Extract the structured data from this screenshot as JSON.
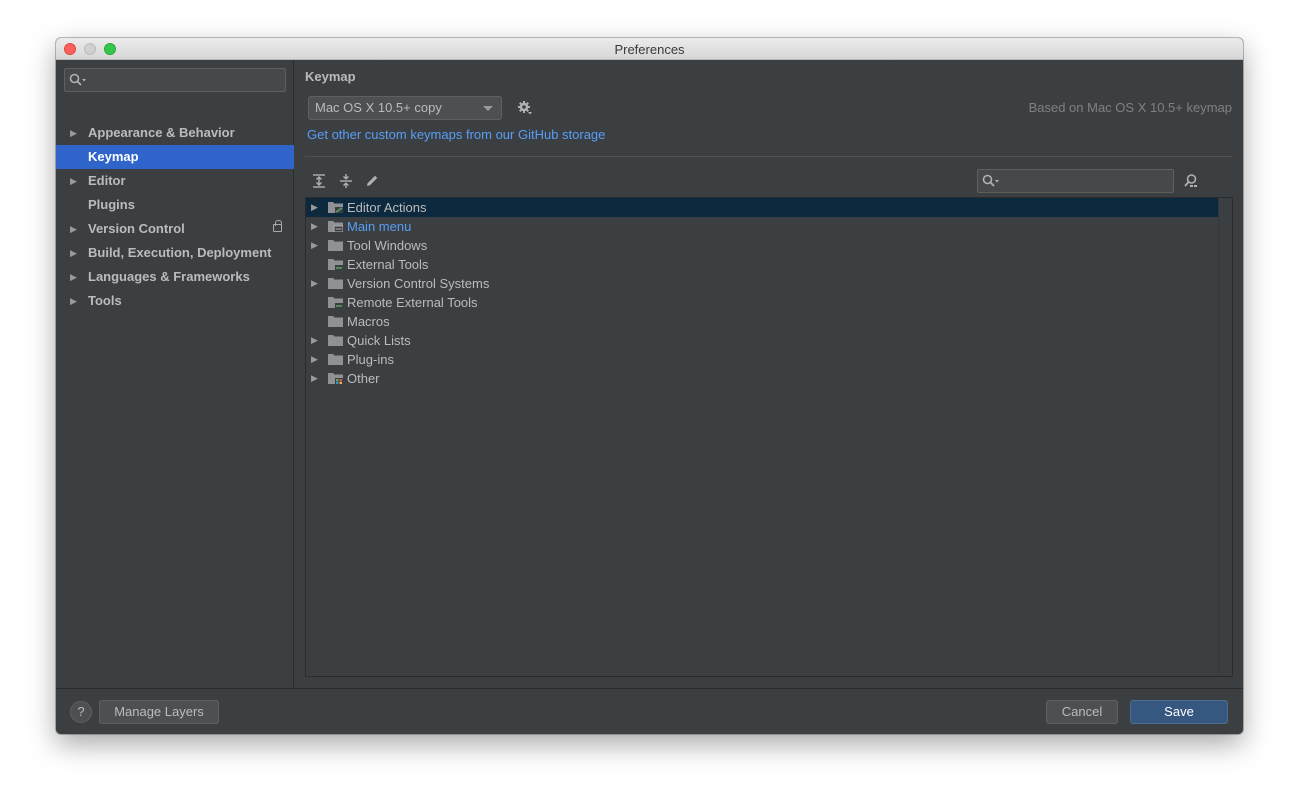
{
  "window": {
    "title": "Preferences"
  },
  "sidebar": {
    "search_placeholder": "",
    "items": [
      {
        "label": "Appearance & Behavior",
        "expandable": true
      },
      {
        "label": "Keymap",
        "expandable": false,
        "selected": true
      },
      {
        "label": "Editor",
        "expandable": true
      },
      {
        "label": "Plugins",
        "expandable": false
      },
      {
        "label": "Version Control",
        "expandable": true,
        "icon": "lock-icon"
      },
      {
        "label": "Build, Execution, Deployment",
        "expandable": true
      },
      {
        "label": "Languages & Frameworks",
        "expandable": true
      },
      {
        "label": "Tools",
        "expandable": true
      }
    ]
  },
  "keymap": {
    "title": "Keymap",
    "selected_keymap": "Mac OS X 10.5+ copy",
    "based_on": "Based on Mac OS X 10.5+ keymap",
    "github_link": "Get other custom keymaps from our GitHub storage"
  },
  "tree": {
    "rows": [
      {
        "label": "Editor Actions",
        "expandable": true,
        "selected": true,
        "icon": "editor-actions-folder-icon"
      },
      {
        "label": "Main menu",
        "expandable": true,
        "link": true,
        "icon": "main-menu-folder-icon"
      },
      {
        "label": "Tool Windows",
        "expandable": true,
        "icon": "folder-icon"
      },
      {
        "label": "External Tools",
        "expandable": false,
        "icon": "external-tools-folder-icon"
      },
      {
        "label": "Version Control Systems",
        "expandable": true,
        "icon": "folder-icon"
      },
      {
        "label": "Remote External Tools",
        "expandable": false,
        "icon": "remote-tools-folder-icon"
      },
      {
        "label": "Macros",
        "expandable": false,
        "icon": "folder-icon"
      },
      {
        "label": "Quick Lists",
        "expandable": true,
        "icon": "folder-icon"
      },
      {
        "label": "Plug-ins",
        "expandable": true,
        "icon": "folder-icon"
      },
      {
        "label": "Other",
        "expandable": true,
        "icon": "other-folder-icon"
      }
    ]
  },
  "buttons": {
    "help": "?",
    "manage_layers": "Manage Layers",
    "cancel": "Cancel",
    "save": "Save"
  },
  "colors": {
    "selection": "#2f65ca",
    "link": "#589df6",
    "background": "#3c3f41",
    "primary_button": "#365880"
  }
}
